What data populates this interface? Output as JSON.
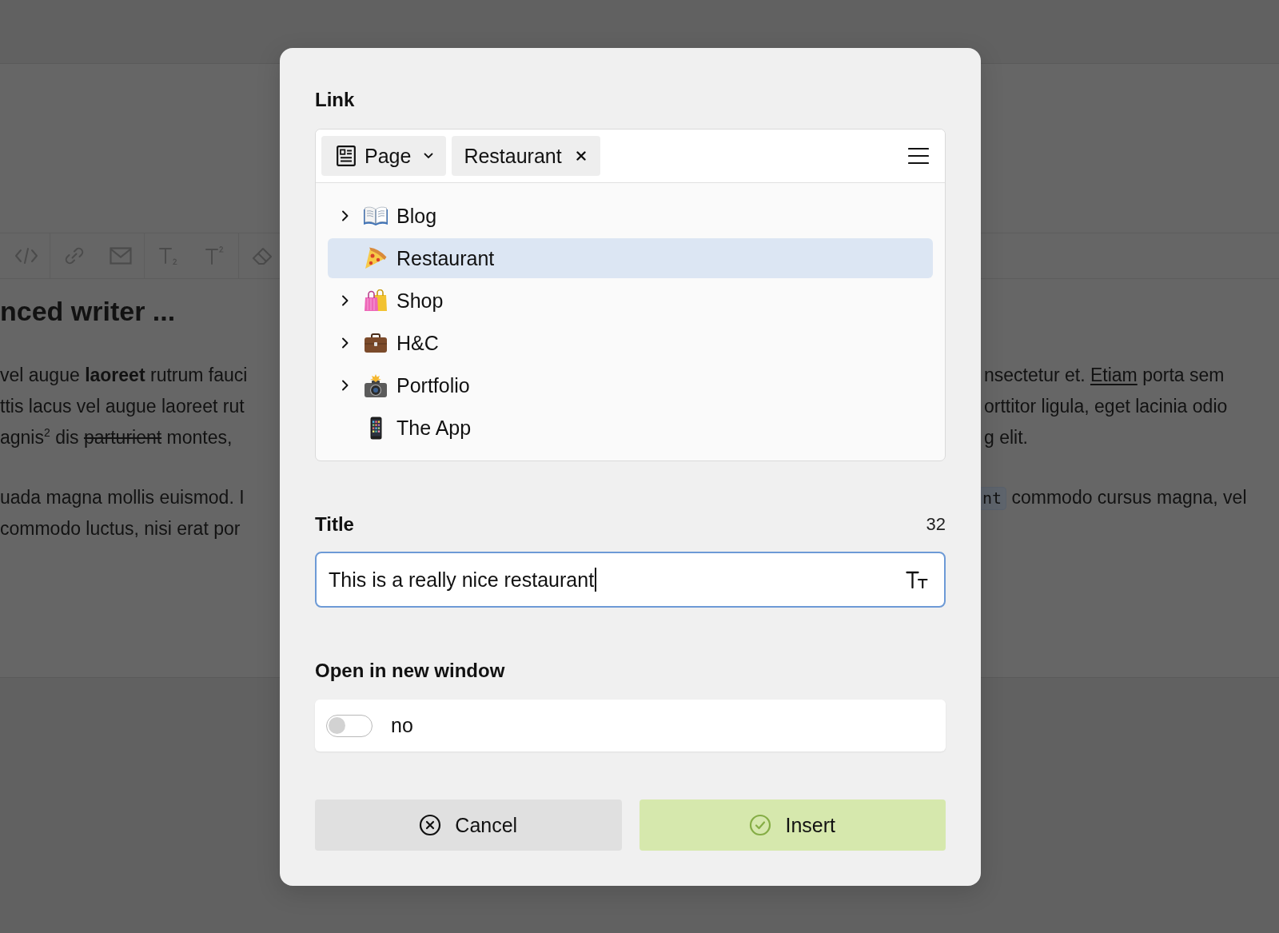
{
  "editor": {
    "heading": "nced writer ...",
    "paragraphs": [
      {
        "left_lines": [
          [
            {
              "kind": "plain",
              "text": "vel augue "
            },
            {
              "kind": "bold",
              "text": "laoreet"
            },
            {
              "kind": "plain",
              "text": " rutrum fauci"
            }
          ],
          [
            {
              "kind": "plain",
              "text": "ttis lacus vel augue laoreet rut"
            }
          ],
          [
            {
              "kind": "plain",
              "text": "agnis"
            },
            {
              "kind": "sup",
              "text": "2"
            },
            {
              "kind": "plain",
              "text": " dis "
            },
            {
              "kind": "strike",
              "text": "parturient"
            },
            {
              "kind": "plain",
              "text": " montes,"
            }
          ]
        ],
        "right_lines": [
          [
            {
              "kind": "plain",
              "text": "nsectetur et. "
            },
            {
              "kind": "link",
              "text": "Etiam"
            },
            {
              "kind": "plain",
              "text": " porta sem"
            }
          ],
          [
            {
              "kind": "plain",
              "text": "orttitor ligula, eget lacinia odio"
            }
          ],
          [
            {
              "kind": "plain",
              "text": "g elit."
            }
          ]
        ]
      },
      {
        "left_lines": [
          [
            {
              "kind": "plain",
              "text": "uada magna mollis euismod. I"
            }
          ],
          [
            {
              "kind": "plain",
              "text": "commodo luctus, nisi erat por"
            }
          ]
        ],
        "right_lines": [
          [
            {
              "kind": "code",
              "text": "nt"
            },
            {
              "kind": "plain",
              "text": " commodo cursus magna, vel"
            }
          ]
        ]
      }
    ]
  },
  "dialog": {
    "link": {
      "label": "Link",
      "type_dropdown": "Page",
      "tag": "Restaurant",
      "tree": [
        {
          "label": "Blog",
          "expandable": true,
          "selected": false
        },
        {
          "label": "Restaurant",
          "expandable": false,
          "selected": true
        },
        {
          "label": "Shop",
          "expandable": true,
          "selected": false
        },
        {
          "label": "H&C",
          "expandable": true,
          "selected": false
        },
        {
          "label": "Portfolio",
          "expandable": true,
          "selected": false
        },
        {
          "label": "The App",
          "expandable": false,
          "selected": false
        }
      ]
    },
    "title": {
      "label": "Title",
      "counter": "32",
      "value": "This is a really nice restaurant",
      "focused": true
    },
    "open_in_new_window": {
      "label": "Open in new window",
      "on": false,
      "state_text": "no"
    },
    "buttons": [
      {
        "label": "Cancel",
        "kind": "cancel"
      },
      {
        "label": "Insert",
        "kind": "confirm"
      }
    ]
  }
}
